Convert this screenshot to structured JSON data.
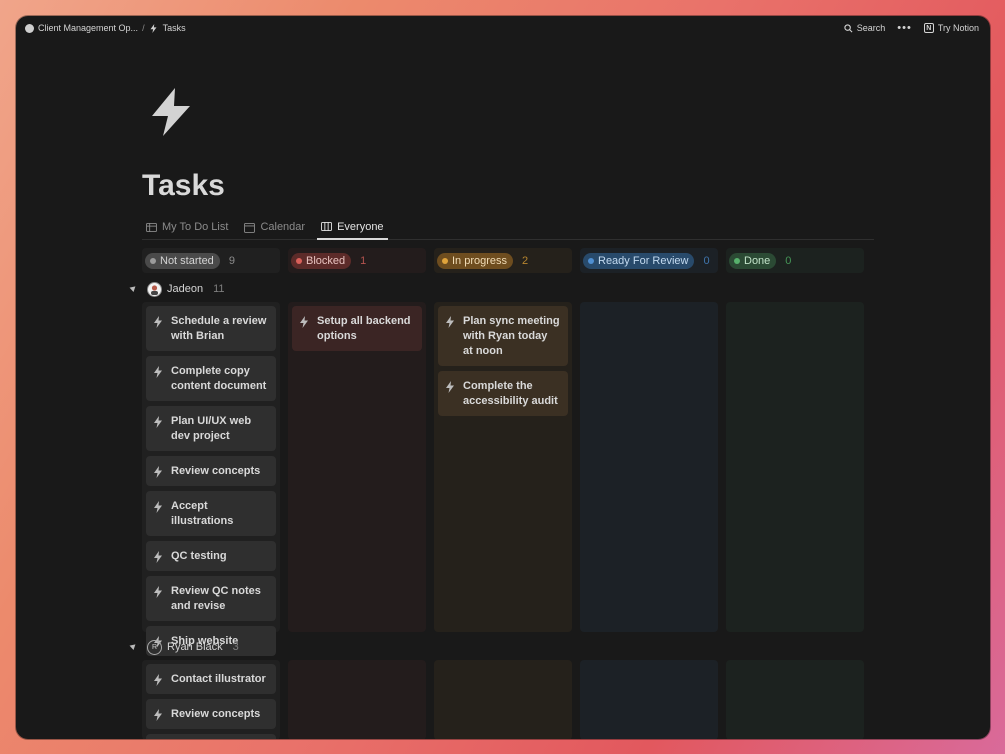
{
  "topbar": {
    "breadcrumb_workspace": "Client Management Op...",
    "breadcrumb_sep": "/",
    "breadcrumb_page": "Tasks",
    "search_label": "Search",
    "more_label": "•••",
    "try_label": "Try Notion"
  },
  "page": {
    "icon": "lightning-bolt-icon",
    "title": "Tasks"
  },
  "tabs": [
    {
      "label": "My To Do List",
      "icon": "table-icon"
    },
    {
      "label": "Calendar",
      "icon": "calendar-icon"
    },
    {
      "label": "Everyone",
      "icon": "board-icon",
      "active": true
    }
  ],
  "columns": [
    {
      "label": "Not started",
      "count": "9",
      "pill_bg": "#4a4a4a",
      "dot": "#9b9b9b",
      "text": "#d4d4d4",
      "count_color": "#8b8b8b",
      "head_bg": "#202020",
      "lane_bg": "#202020",
      "card_bg": "#2f2f2f"
    },
    {
      "label": "Blocked",
      "count": "1",
      "pill_bg": "#5c2b29",
      "dot": "#d9605a",
      "text": "#e8c3c0",
      "count_color": "#b5544f",
      "head_bg": "#231c1c",
      "lane_bg": "#231c1c",
      "card_bg": "#3b2524"
    },
    {
      "label": "In progress",
      "count": "2",
      "pill_bg": "#6e4d1f",
      "dot": "#e0a33b",
      "text": "#f1dcb6",
      "count_color": "#b7852e",
      "head_bg": "#25211b",
      "lane_bg": "#25211b",
      "card_bg": "#3b3023"
    },
    {
      "label": "Ready For Review",
      "count": "0",
      "pill_bg": "#284a6b",
      "dot": "#4f8fd1",
      "text": "#c4dbf1",
      "count_color": "#3f74ab",
      "head_bg": "#1c2126",
      "lane_bg": "#1c2126",
      "card_bg": "#25303b"
    },
    {
      "label": "Done",
      "count": "0",
      "pill_bg": "#2b4a34",
      "dot": "#57b16c",
      "text": "#c2e3c9",
      "count_color": "#459557",
      "head_bg": "#1c221f",
      "lane_bg": "#1c221f",
      "card_bg": "#263129"
    }
  ],
  "groups": [
    {
      "name": "Jadeon",
      "count": "11",
      "avatar": "photo-avatar",
      "lanes": [
        [
          "Schedule a review with Brian",
          "Complete copy content document",
          "Plan UI/UX web dev project",
          "Review concepts",
          "Accept illustrations",
          "QC testing",
          "Review QC notes and revise",
          "Ship website"
        ],
        [
          "Setup all backend options"
        ],
        [
          "Plan sync meeting with Ryan today at noon",
          "Complete the accessibility audit"
        ],
        [],
        []
      ]
    },
    {
      "name": "Ryan Black",
      "count": "3",
      "avatar_initial": "R",
      "lanes": [
        [
          "Contact illustrator",
          "Review concepts",
          ""
        ],
        [],
        [],
        [],
        []
      ]
    }
  ]
}
